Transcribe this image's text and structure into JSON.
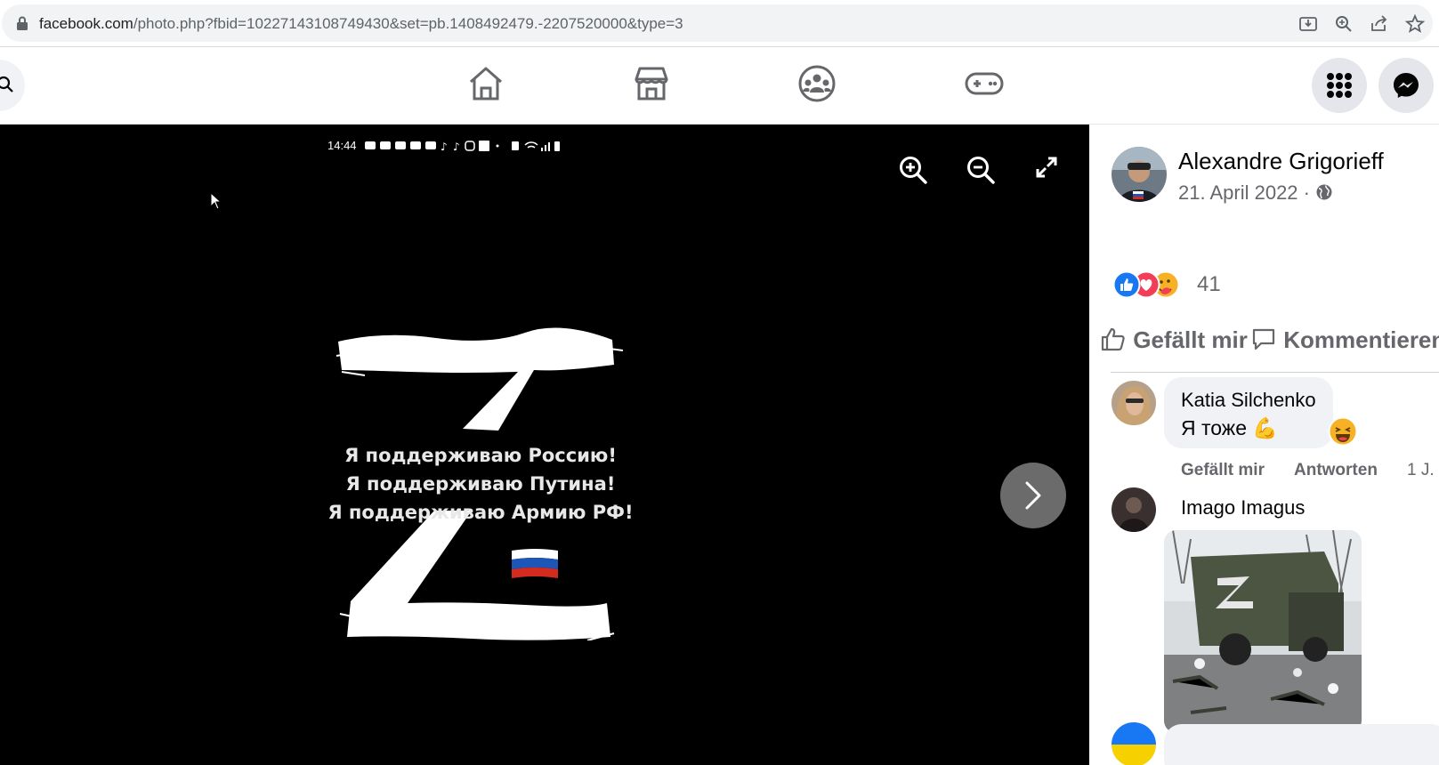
{
  "browser": {
    "url_domain": "facebook.com",
    "url_path": "/photo.php?fbid=10227143108749430&set=pb.1408492479.-2207520000&type=3"
  },
  "viewer": {
    "status_time": "14:44",
    "image_text": [
      "Я поддерживаю Россию!",
      "Я поддерживаю Путина!",
      "Я поддерживаю Армию РФ!"
    ]
  },
  "post": {
    "author": "Alexandre Grigorieff",
    "date": "21. April 2022 ·",
    "reaction_count": "41",
    "like_label": "Gefällt mir",
    "comment_label": "Kommentieren"
  },
  "comments": [
    {
      "author": "Katia Silchenko",
      "text": "Я тоже 💪",
      "like_label": "Gefällt mir",
      "reply_label": "Antworten",
      "time": "1 J."
    },
    {
      "author": "Imago Imagus"
    }
  ],
  "colors": {
    "fb_blue": "#1877f2",
    "love_red": "#f33e58",
    "care_yellow": "#f7b125",
    "secondary_text": "#65676b"
  }
}
